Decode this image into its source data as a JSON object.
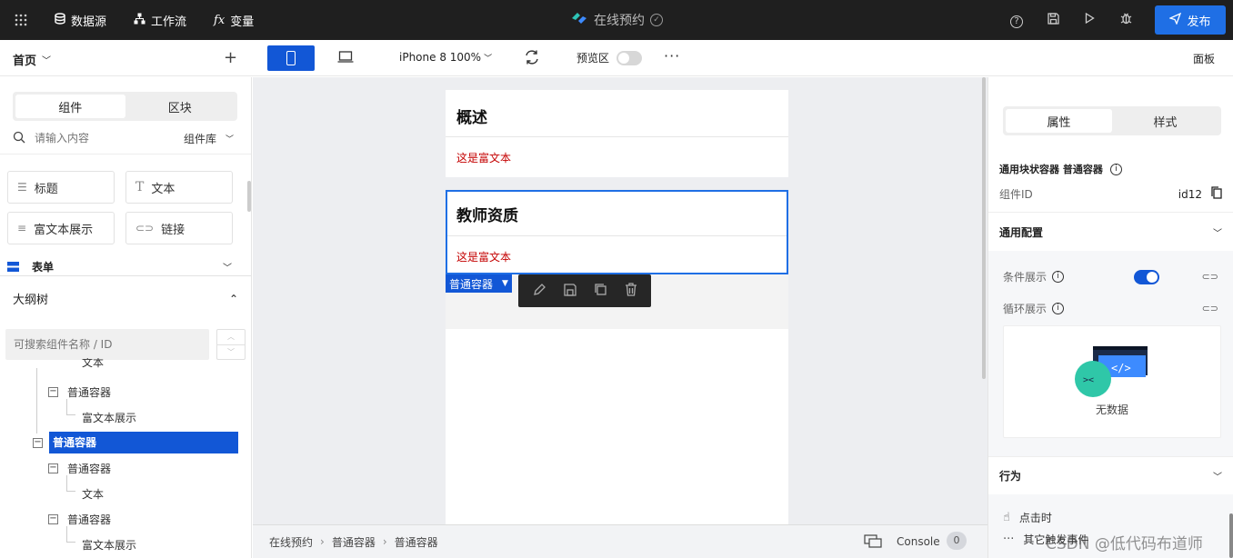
{
  "topbar": {
    "items": [
      {
        "icon": "database-icon",
        "label": "数据源"
      },
      {
        "icon": "workflow-icon",
        "label": "工作流"
      },
      {
        "icon": "fx-icon",
        "label": "变量"
      }
    ],
    "app_title": "在线预约",
    "publish_label": "发布"
  },
  "toolbar": {
    "page_label": "首页",
    "device_label": "iPhone 8 100%",
    "preview_label": "预览区",
    "panel_label": "面板"
  },
  "left": {
    "tabs": [
      "组件",
      "区块"
    ],
    "search_placeholder": "请输入内容",
    "library_label": "组件库",
    "components": [
      "标题",
      "文本",
      "富文本展示",
      "链接"
    ],
    "form_section": "表单",
    "outline_title": "大纲树",
    "outline_search_placeholder": "可搜索组件名称 / ID",
    "tree": [
      {
        "label": "文本",
        "level": 3
      },
      {
        "label": "普通容器",
        "level": 2,
        "collapsible": true
      },
      {
        "label": "富文本展示",
        "level": 3
      },
      {
        "label": "普通容器",
        "level": 1,
        "collapsible": true,
        "selected": true
      },
      {
        "label": "普通容器",
        "level": 2,
        "collapsible": true
      },
      {
        "label": "文本",
        "level": 3
      },
      {
        "label": "普通容器",
        "level": 2,
        "collapsible": true
      },
      {
        "label": "富文本展示",
        "level": 3
      }
    ]
  },
  "canvas": {
    "sections": [
      {
        "title": "概述",
        "richtext": "这是富文本"
      },
      {
        "title": "教师资质",
        "richtext": "这是富文本"
      }
    ],
    "selected_tag": "普通容器",
    "breadcrumb": [
      "在线预约",
      "普通容器",
      "普通容器"
    ],
    "console_label": "Console",
    "console_count": "0"
  },
  "right": {
    "tabs": [
      "属性",
      "样式"
    ],
    "component_type": "通用块状容器 普通容器",
    "component_id_label": "组件ID",
    "component_id": "id12",
    "general_config": "通用配置",
    "conditional_display": "条件展示",
    "conditional_display_on": true,
    "loop_display": "循环展示",
    "empty_text": "无数据",
    "behavior": "行为",
    "on_click": "点击时",
    "other_events": "其它触发事件"
  },
  "watermark": "CSDN @低代码布道师",
  "colors": {
    "accent": "#1257d6",
    "topbar": "#1f1f1f",
    "richtext": "#c40000"
  }
}
